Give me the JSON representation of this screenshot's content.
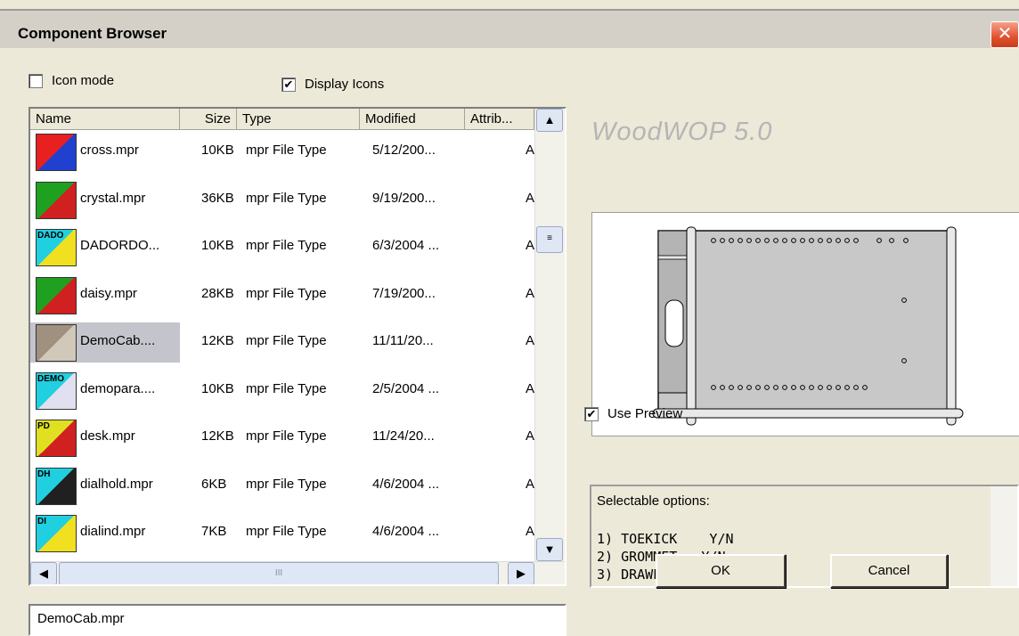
{
  "window": {
    "title": "Component Browser",
    "close_symbol": "✕"
  },
  "checks": {
    "icon_mode": {
      "label": "Icon mode",
      "checked": false
    },
    "display_icons": {
      "label": "Display Icons",
      "checked": true,
      "mark": "✔"
    },
    "use_preview": {
      "label": "Use Preview",
      "checked": true,
      "mark": "✔"
    }
  },
  "list": {
    "columns": [
      "Name",
      "Size",
      "Type",
      "Modified",
      "Attrib..."
    ],
    "rows": [
      {
        "name": "cross.mpr",
        "size": "10KB",
        "type": "mpr File Type",
        "modified": "5/12/200...",
        "attrib": "A",
        "icon": "cross-icon"
      },
      {
        "name": "crystal.mpr",
        "size": "36KB",
        "type": "mpr File Type",
        "modified": "9/19/200...",
        "attrib": "A",
        "icon": "blocks-icon"
      },
      {
        "name": "DADORDO...",
        "size": "10KB",
        "type": "mpr File Type",
        "modified": "6/3/2004 ...",
        "attrib": "A",
        "icon": "dado-icon",
        "icon_text": "DADO"
      },
      {
        "name": "daisy.mpr",
        "size": "28KB",
        "type": "mpr File Type",
        "modified": "7/19/200...",
        "attrib": "A",
        "icon": "blocks-icon"
      },
      {
        "name": "DemoCab....",
        "size": "12KB",
        "type": "mpr File Type",
        "modified": "11/11/20...",
        "attrib": "A",
        "icon": "cabinet-icon",
        "selected": true
      },
      {
        "name": "demopara....",
        "size": "10KB",
        "type": "mpr File Type",
        "modified": "2/5/2004 ...",
        "attrib": "A",
        "icon": "demo-icon",
        "icon_text": "DEMO"
      },
      {
        "name": "desk.mpr",
        "size": "12KB",
        "type": "mpr File Type",
        "modified": "11/24/20...",
        "attrib": "A",
        "icon": "desk-icon",
        "icon_text": "PD"
      },
      {
        "name": "dialhold.mpr",
        "size": "6KB",
        "type": "mpr File Type",
        "modified": "4/6/2004 ...",
        "attrib": "A",
        "icon": "dialhold-icon",
        "icon_text": "DH"
      },
      {
        "name": "dialind.mpr",
        "size": "7KB",
        "type": "mpr File Type",
        "modified": "4/6/2004 ...",
        "attrib": "A",
        "icon": "dial-icon",
        "icon_text": "DI"
      }
    ],
    "scroll": {
      "up": "▲",
      "down": "▼",
      "left": "◀",
      "right": "▶",
      "grip": "III"
    }
  },
  "filename": {
    "value": "DemoCab.mpr"
  },
  "brand": "WoodWOP 5.0",
  "options": {
    "title": "Selectable options:",
    "items": [
      "1) TOEKICK    Y/N",
      "2) GROMMET   Y/N",
      "3) DRAWER     Y/N"
    ]
  },
  "buttons": {
    "ok": "OK",
    "cancel": "Cancel"
  }
}
